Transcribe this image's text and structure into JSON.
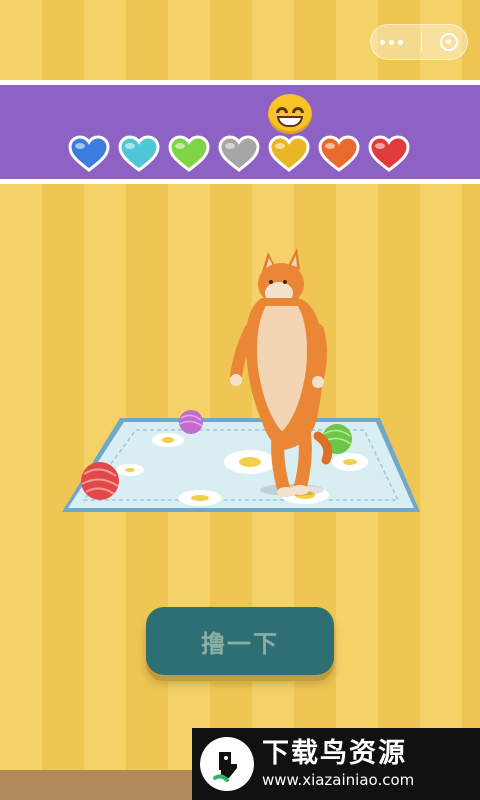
{
  "capsule": {
    "more_icon": "more-dots-icon",
    "close_icon": "target-close-icon"
  },
  "mood": {
    "emoji_icon": "grinning-face-icon",
    "hearts": [
      {
        "color": "#3d7de0",
        "name": "blue-heart"
      },
      {
        "color": "#4fc7d6",
        "name": "cyan-heart"
      },
      {
        "color": "#7cd446",
        "name": "green-heart"
      },
      {
        "color": "#a6a6a6",
        "name": "gray-heart"
      },
      {
        "color": "#e8b726",
        "name": "yellow-heart"
      },
      {
        "color": "#ea6a2d",
        "name": "orange-heart"
      },
      {
        "color": "#e13b3e",
        "name": "red-heart"
      }
    ]
  },
  "action": {
    "pet_label": "撸一下"
  },
  "watermark": {
    "title": "下载鸟资源",
    "url": "www.xiazainiao.com"
  }
}
